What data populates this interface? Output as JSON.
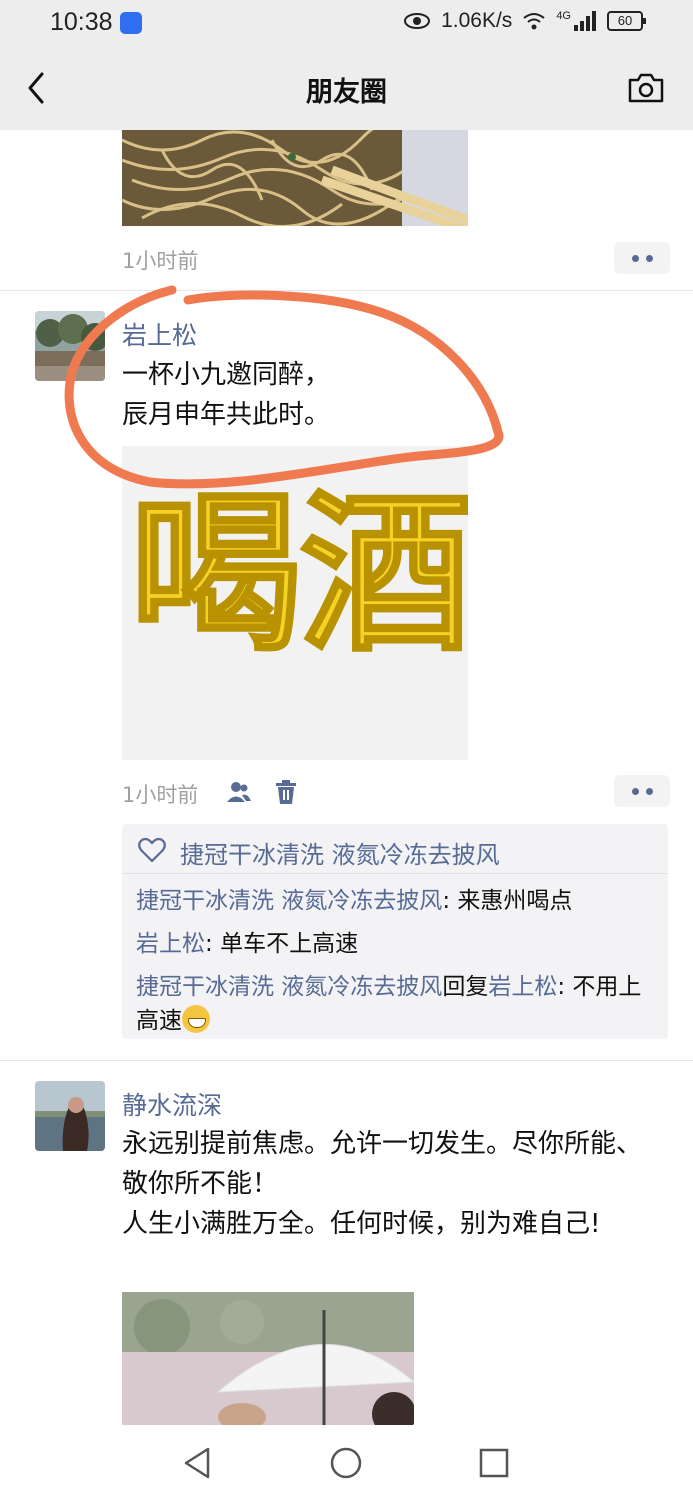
{
  "status_bar": {
    "time": "10:38",
    "net_speed": "1.06K/s",
    "network": "4G",
    "battery": "60"
  },
  "nav": {
    "title": "朋友圈"
  },
  "feed": {
    "top_post": {
      "time": "1小时前"
    },
    "post1": {
      "author": "岩上松",
      "lines": [
        "一杯小九邀同醉，",
        "辰月申年共此时。"
      ],
      "image_text": [
        "喝",
        "酒"
      ],
      "time": "1小时前",
      "likes": "捷冠干冰清洗  液氮冷冻去披风",
      "comments": [
        {
          "user": "捷冠干冰清洗  液氮冷冻去披风",
          "sep": ": ",
          "text": "来惠州喝点"
        },
        {
          "user": "岩上松",
          "sep": ": ",
          "text": "单车不上高速"
        },
        {
          "user": "捷冠干冰清洗  液氮冷冻去披风",
          "reply_word": "回复",
          "reply_to": "岩上松",
          "sep": ": ",
          "text": "不用上高速"
        }
      ]
    },
    "post2": {
      "author": "静水流深",
      "lines": [
        "永远别提前焦虑。允许一切发生。尽你所能、敬你所不能！",
        "人生小满胜万全。任何时候，别为难自己!"
      ]
    }
  },
  "colors": {
    "bar_bg": "#ededed",
    "name_blue": "#576b95",
    "annotation_red": "#f07a50"
  }
}
